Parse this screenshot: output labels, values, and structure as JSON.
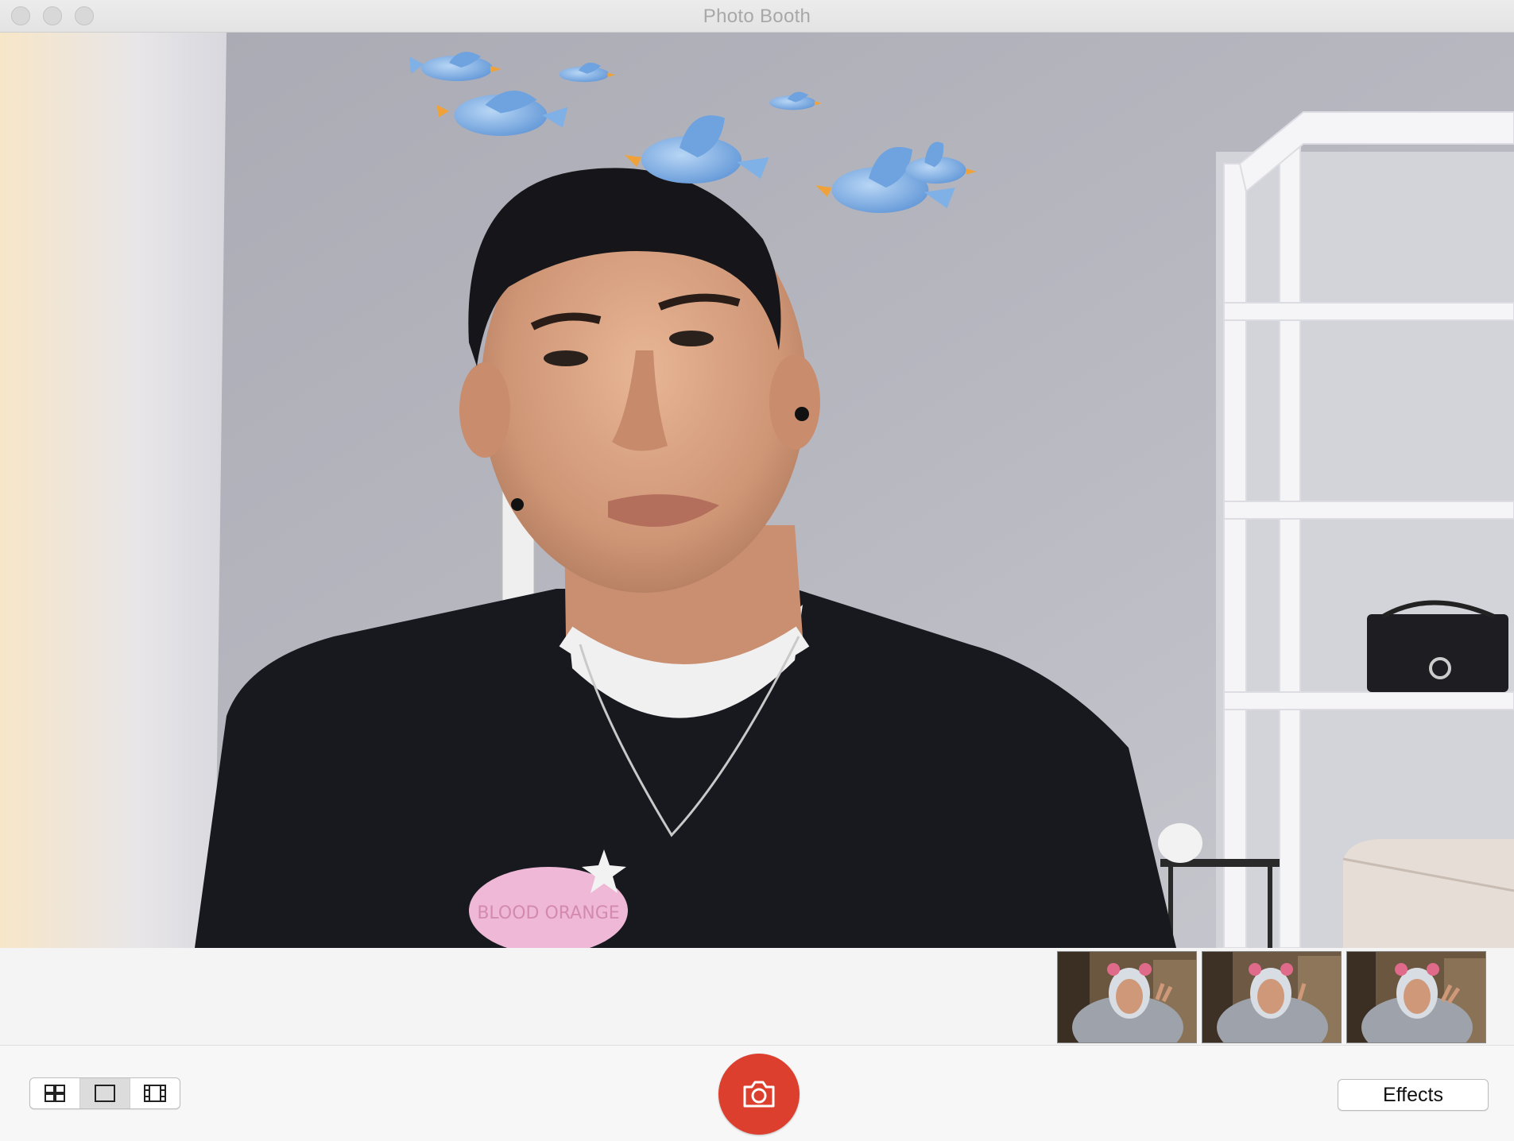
{
  "window": {
    "title": "Photo Booth"
  },
  "thumbnails": [
    {
      "name": "photo-1"
    },
    {
      "name": "photo-2"
    },
    {
      "name": "photo-3"
    }
  ],
  "toolbar": {
    "layout_modes": [
      "four-up",
      "single",
      "video"
    ],
    "active_mode": "single",
    "effects_label": "Effects"
  },
  "preview": {
    "shirt_text": "BLOOD ORANGE"
  },
  "colors": {
    "shutter": "#dc3f2e",
    "bird": "#7fb1e6"
  }
}
